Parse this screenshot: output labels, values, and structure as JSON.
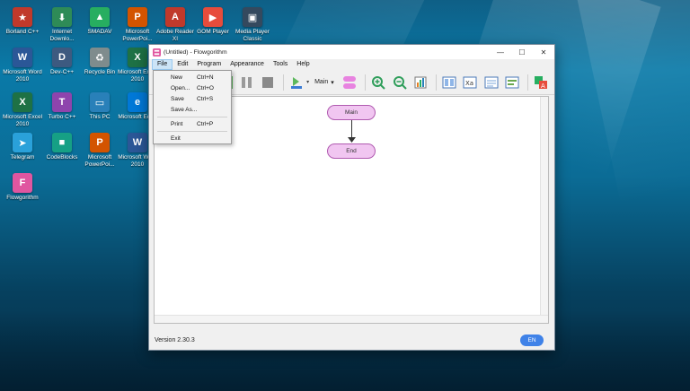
{
  "desktop": {
    "icons": [
      {
        "label": "Borland C++",
        "color": "#c0392b",
        "glyph": "★"
      },
      {
        "label": "Internet Downlo...",
        "color": "#2e8b57",
        "glyph": "⬇"
      },
      {
        "label": "SMADAV",
        "color": "#27ae60",
        "glyph": "▲"
      },
      {
        "label": "Microsoft PowerPoi...",
        "color": "#d35400",
        "glyph": "P"
      },
      {
        "label": "Adobe Reader XI",
        "color": "#c0392b",
        "glyph": "A"
      },
      {
        "label": "GOM Player",
        "color": "#e74c3c",
        "glyph": "▶"
      },
      {
        "label": "Media Player Classic",
        "color": "#34495e",
        "glyph": "▣"
      },
      {
        "label": "Microsoft Word 2010",
        "color": "#2b5797",
        "glyph": "W"
      },
      {
        "label": "Dev-C++",
        "color": "#3d5a80",
        "glyph": "D"
      },
      {
        "label": "Recycle Bin",
        "color": "#7f8c8d",
        "glyph": "♻"
      },
      {
        "label": "Microsoft Excel 2010",
        "color": "#1e7145",
        "glyph": "X"
      },
      {
        "label": "Microsoft Excel 2010",
        "color": "#1e7145",
        "glyph": "X"
      },
      {
        "label": "Turbo C++",
        "color": "#8e44ad",
        "glyph": "T"
      },
      {
        "label": "This PC",
        "color": "#2980b9",
        "glyph": "▭"
      },
      {
        "label": "Microsoft Edge",
        "color": "#0078d7",
        "glyph": "e"
      },
      {
        "label": "Telegram",
        "color": "#2aa1da",
        "glyph": "➤"
      },
      {
        "label": "CodeBlocks",
        "color": "#16a085",
        "glyph": "■"
      },
      {
        "label": "Microsoft PowerPoi...",
        "color": "#d35400",
        "glyph": "P"
      },
      {
        "label": "Microsoft Word 2010",
        "color": "#2b5797",
        "glyph": "W"
      },
      {
        "label": "Flowgorithm",
        "color": "#e056a0",
        "glyph": "F"
      }
    ]
  },
  "window": {
    "title": "(Untitled) - Flowgorithm",
    "controls": {
      "minimize": "—",
      "maximize": "☐",
      "close": "✕"
    },
    "menus": [
      "File",
      "Edit",
      "Program",
      "Appearance",
      "Tools",
      "Help"
    ],
    "toolbar": {
      "main_select": "Main"
    },
    "file_menu": {
      "items": [
        {
          "label": "New",
          "shortcut": "Ctrl+N"
        },
        {
          "label": "Open...",
          "shortcut": "Ctrl+O"
        },
        {
          "label": "Save",
          "shortcut": "Ctrl+S"
        },
        {
          "label": "Save As...",
          "shortcut": ""
        },
        {
          "label": "Print",
          "shortcut": "Ctrl+P"
        },
        {
          "label": "Exit",
          "shortcut": ""
        }
      ]
    },
    "flowchart": {
      "start": "Main",
      "end": "End"
    },
    "status": {
      "version": "Version 2.30.3",
      "language": "EN"
    }
  },
  "colors": {
    "node_fill": "#f1c6f1",
    "node_border": "#b05ab0",
    "accent": "#3f82e8"
  }
}
